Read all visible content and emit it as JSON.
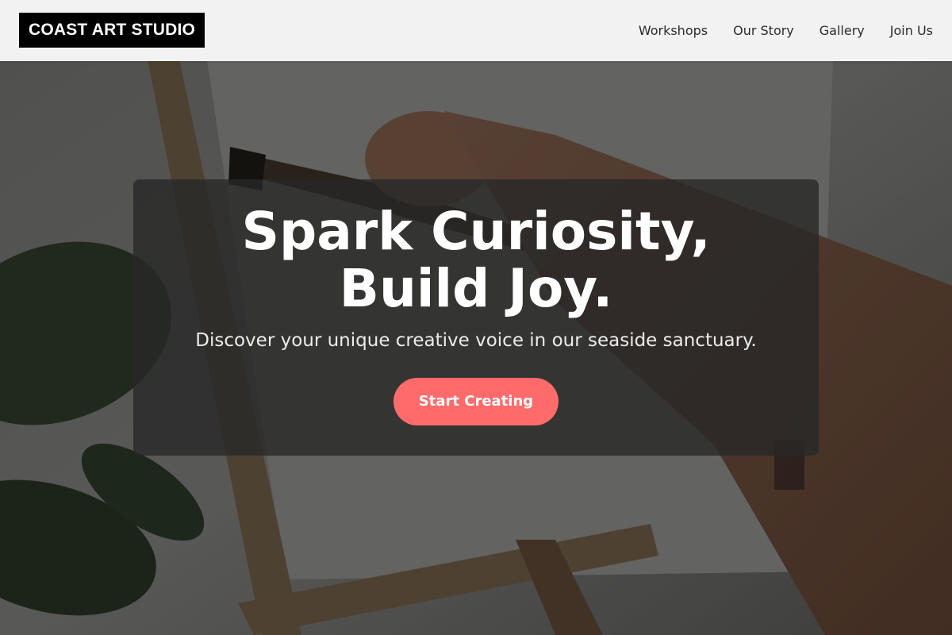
{
  "header": {
    "logo": "COAST ART STUDIO",
    "nav": [
      "Workshops",
      "Our Story",
      "Gallery",
      "Join Us"
    ]
  },
  "hero": {
    "title_line1": "Spark Curiosity,",
    "title_line2": "Build Joy.",
    "subtitle": "Discover your unique creative voice in our seaside sanctuary.",
    "cta_label": "Start Creating"
  },
  "colors": {
    "header_bg": "#f2f2f2",
    "logo_bg": "#000000",
    "cta_bg": "#ff6b6b",
    "panel_bg": "rgba(40,40,40,0.8)"
  }
}
